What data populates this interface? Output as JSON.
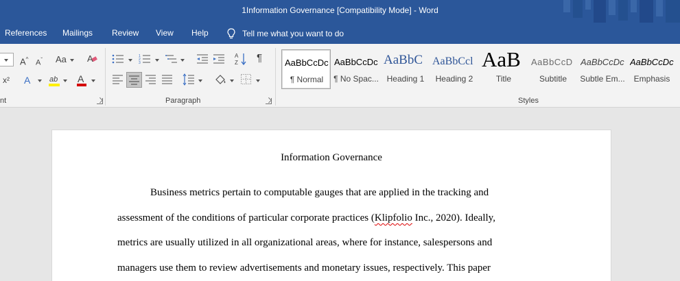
{
  "window": {
    "title": "1Information Governance [Compatibility Mode]  -  Word"
  },
  "menu": {
    "tabs": [
      "References",
      "Mailings",
      "Review",
      "View",
      "Help"
    ],
    "tell_me": "Tell me what you want to do"
  },
  "ribbon": {
    "groups": {
      "font_label": "nt",
      "paragraph_label": "Paragraph",
      "styles_label": "Styles"
    },
    "styles": [
      {
        "sample": "AaBbCcDc",
        "name": "¶ Normal"
      },
      {
        "sample": "AaBbCcDc",
        "name": "¶ No Spac..."
      },
      {
        "sample": "AaBbC",
        "name": "Heading 1"
      },
      {
        "sample": "AaBbCcl",
        "name": "Heading 2"
      },
      {
        "sample": "AaB",
        "name": "Title"
      },
      {
        "sample": "AaBbCcD",
        "name": "Subtitle"
      },
      {
        "sample": "AaBbCcDc",
        "name": "Subtle Em..."
      },
      {
        "sample": "AaBbCcDc",
        "name": "Emphasis"
      }
    ]
  },
  "document": {
    "title": "Information Governance",
    "lines": {
      "l1": "Business metrics pertain to computable gauges that are applied in the tracking and",
      "l2a": "assessment of the conditions of particular corporate practices (",
      "l2b": "Klipfolio",
      "l2c": " Inc., 2020). Ideally,",
      "l3": "metrics are usually utilized in all organizational areas, where for instance, salespersons and",
      "l4": "managers use them to review advertisements and monetary issues, respectively. This paper"
    }
  },
  "colors": {
    "accent": "#2b579a",
    "spell_error": "#dd0000"
  }
}
